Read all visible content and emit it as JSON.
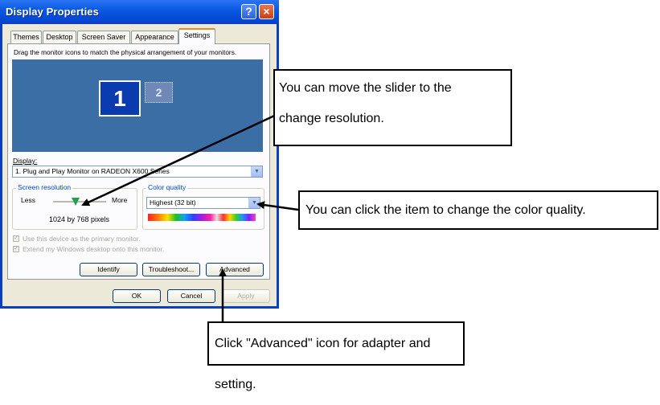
{
  "window": {
    "title": "Display Properties",
    "help_label": "?",
    "close_label": "×"
  },
  "tabs": [
    {
      "label": "Themes",
      "active": false
    },
    {
      "label": "Desktop",
      "active": false
    },
    {
      "label": "Screen Saver",
      "active": false
    },
    {
      "label": "Appearance",
      "active": false
    },
    {
      "label": "Settings",
      "active": true
    }
  ],
  "settings": {
    "instruction": "Drag the monitor icons to match the physical arrangement of your monitors.",
    "monitors": [
      {
        "label": "1",
        "selected": true
      },
      {
        "label": "2",
        "selected": false
      }
    ],
    "display_label": "Display:",
    "display_value": "1. Plug and Play Monitor on RADEON X600 Series",
    "screen_resolution": {
      "title": "Screen resolution",
      "less_label": "Less",
      "more_label": "More",
      "value": "1024 by 768 pixels"
    },
    "color_quality": {
      "title": "Color quality",
      "value": "Highest (32 bit)"
    },
    "checkboxes": [
      {
        "label": "Use this device as the primary monitor.",
        "checked": true,
        "enabled": false
      },
      {
        "label": "Extend my Windows desktop onto this monitor.",
        "checked": true,
        "enabled": false
      }
    ],
    "buttons": {
      "identify": "Identify",
      "troubleshoot": "Troubleshoot...",
      "advanced": "Advanced"
    }
  },
  "dialog_buttons": {
    "ok": "OK",
    "cancel": "Cancel",
    "apply": "Apply"
  },
  "callouts": {
    "slider_line1": "You can move the slider to the",
    "slider_line2": "change resolution.",
    "color": "You can click the item to change the color quality.",
    "advanced": "Click \"Advanced\" icon for adapter and setting."
  },
  "colors": {
    "titlebar": "#0a5ae0",
    "desktop_preview": "#3a6ea5",
    "window_bg": "#ece9d8",
    "active_tab_accent": "#e68b2c",
    "group_title": "#0046d5"
  },
  "icons": [
    "help-icon",
    "close-icon",
    "dropdown-arrow-icon",
    "slider-thumb-icon",
    "checkbox-icon"
  ]
}
